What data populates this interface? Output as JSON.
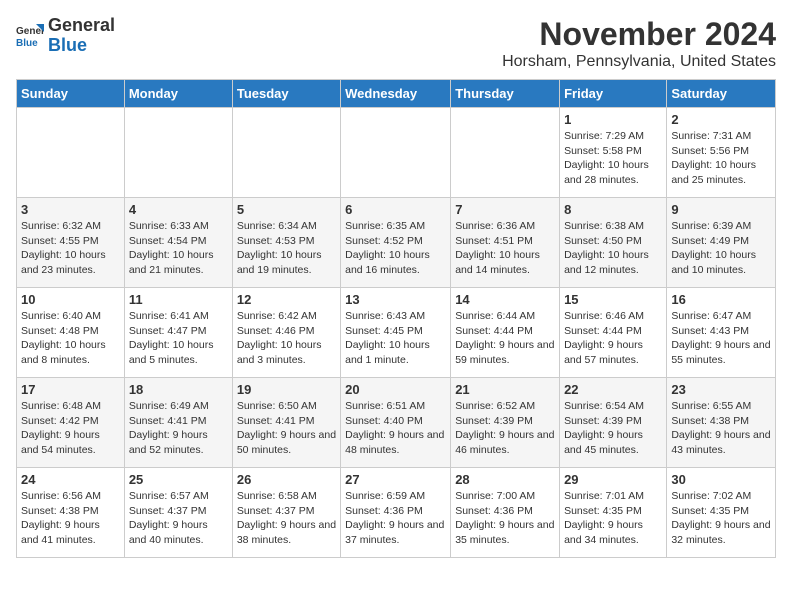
{
  "logo": {
    "general": "General",
    "blue": "Blue"
  },
  "header": {
    "title": "November 2024",
    "subtitle": "Horsham, Pennsylvania, United States"
  },
  "days_of_week": [
    "Sunday",
    "Monday",
    "Tuesday",
    "Wednesday",
    "Thursday",
    "Friday",
    "Saturday"
  ],
  "weeks": [
    [
      {
        "day": "",
        "info": ""
      },
      {
        "day": "",
        "info": ""
      },
      {
        "day": "",
        "info": ""
      },
      {
        "day": "",
        "info": ""
      },
      {
        "day": "",
        "info": ""
      },
      {
        "day": "1",
        "info": "Sunrise: 7:29 AM\nSunset: 5:58 PM\nDaylight: 10 hours and 28 minutes."
      },
      {
        "day": "2",
        "info": "Sunrise: 7:31 AM\nSunset: 5:56 PM\nDaylight: 10 hours and 25 minutes."
      }
    ],
    [
      {
        "day": "3",
        "info": "Sunrise: 6:32 AM\nSunset: 4:55 PM\nDaylight: 10 hours and 23 minutes."
      },
      {
        "day": "4",
        "info": "Sunrise: 6:33 AM\nSunset: 4:54 PM\nDaylight: 10 hours and 21 minutes."
      },
      {
        "day": "5",
        "info": "Sunrise: 6:34 AM\nSunset: 4:53 PM\nDaylight: 10 hours and 19 minutes."
      },
      {
        "day": "6",
        "info": "Sunrise: 6:35 AM\nSunset: 4:52 PM\nDaylight: 10 hours and 16 minutes."
      },
      {
        "day": "7",
        "info": "Sunrise: 6:36 AM\nSunset: 4:51 PM\nDaylight: 10 hours and 14 minutes."
      },
      {
        "day": "8",
        "info": "Sunrise: 6:38 AM\nSunset: 4:50 PM\nDaylight: 10 hours and 12 minutes."
      },
      {
        "day": "9",
        "info": "Sunrise: 6:39 AM\nSunset: 4:49 PM\nDaylight: 10 hours and 10 minutes."
      }
    ],
    [
      {
        "day": "10",
        "info": "Sunrise: 6:40 AM\nSunset: 4:48 PM\nDaylight: 10 hours and 8 minutes."
      },
      {
        "day": "11",
        "info": "Sunrise: 6:41 AM\nSunset: 4:47 PM\nDaylight: 10 hours and 5 minutes."
      },
      {
        "day": "12",
        "info": "Sunrise: 6:42 AM\nSunset: 4:46 PM\nDaylight: 10 hours and 3 minutes."
      },
      {
        "day": "13",
        "info": "Sunrise: 6:43 AM\nSunset: 4:45 PM\nDaylight: 10 hours and 1 minute."
      },
      {
        "day": "14",
        "info": "Sunrise: 6:44 AM\nSunset: 4:44 PM\nDaylight: 9 hours and 59 minutes."
      },
      {
        "day": "15",
        "info": "Sunrise: 6:46 AM\nSunset: 4:44 PM\nDaylight: 9 hours and 57 minutes."
      },
      {
        "day": "16",
        "info": "Sunrise: 6:47 AM\nSunset: 4:43 PM\nDaylight: 9 hours and 55 minutes."
      }
    ],
    [
      {
        "day": "17",
        "info": "Sunrise: 6:48 AM\nSunset: 4:42 PM\nDaylight: 9 hours and 54 minutes."
      },
      {
        "day": "18",
        "info": "Sunrise: 6:49 AM\nSunset: 4:41 PM\nDaylight: 9 hours and 52 minutes."
      },
      {
        "day": "19",
        "info": "Sunrise: 6:50 AM\nSunset: 4:41 PM\nDaylight: 9 hours and 50 minutes."
      },
      {
        "day": "20",
        "info": "Sunrise: 6:51 AM\nSunset: 4:40 PM\nDaylight: 9 hours and 48 minutes."
      },
      {
        "day": "21",
        "info": "Sunrise: 6:52 AM\nSunset: 4:39 PM\nDaylight: 9 hours and 46 minutes."
      },
      {
        "day": "22",
        "info": "Sunrise: 6:54 AM\nSunset: 4:39 PM\nDaylight: 9 hours and 45 minutes."
      },
      {
        "day": "23",
        "info": "Sunrise: 6:55 AM\nSunset: 4:38 PM\nDaylight: 9 hours and 43 minutes."
      }
    ],
    [
      {
        "day": "24",
        "info": "Sunrise: 6:56 AM\nSunset: 4:38 PM\nDaylight: 9 hours and 41 minutes."
      },
      {
        "day": "25",
        "info": "Sunrise: 6:57 AM\nSunset: 4:37 PM\nDaylight: 9 hours and 40 minutes."
      },
      {
        "day": "26",
        "info": "Sunrise: 6:58 AM\nSunset: 4:37 PM\nDaylight: 9 hours and 38 minutes."
      },
      {
        "day": "27",
        "info": "Sunrise: 6:59 AM\nSunset: 4:36 PM\nDaylight: 9 hours and 37 minutes."
      },
      {
        "day": "28",
        "info": "Sunrise: 7:00 AM\nSunset: 4:36 PM\nDaylight: 9 hours and 35 minutes."
      },
      {
        "day": "29",
        "info": "Sunrise: 7:01 AM\nSunset: 4:35 PM\nDaylight: 9 hours and 34 minutes."
      },
      {
        "day": "30",
        "info": "Sunrise: 7:02 AM\nSunset: 4:35 PM\nDaylight: 9 hours and 32 minutes."
      }
    ]
  ]
}
